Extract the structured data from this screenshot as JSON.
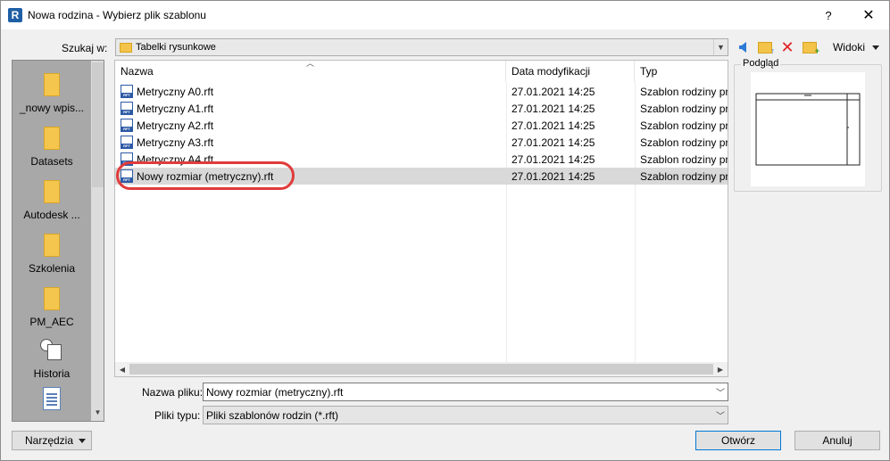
{
  "window": {
    "title": "Nowa rodzina - Wybierz plik szablonu",
    "app_icon_letter": "R",
    "help_label": "?",
    "close_label": "✕"
  },
  "lookin": {
    "label": "Szukaj w:",
    "value": "Tabelki rysunkowe"
  },
  "toolbar": {
    "views_label": "Widoki"
  },
  "places": [
    {
      "label": "_nowy wpis..."
    },
    {
      "label": "Datasets"
    },
    {
      "label": "Autodesk ..."
    },
    {
      "label": "Szkolenia"
    },
    {
      "label": "PM_AEC"
    },
    {
      "label": "Historia"
    }
  ],
  "filelist": {
    "columns": {
      "name": "Nazwa",
      "date": "Data modyfikacji",
      "type": "Typ"
    },
    "rows": [
      {
        "name": "Metryczny A0.rft",
        "date": "27.01.2021 14:25",
        "type": "Szablon rodziny pr..."
      },
      {
        "name": "Metryczny A1.rft",
        "date": "27.01.2021 14:25",
        "type": "Szablon rodziny pr..."
      },
      {
        "name": "Metryczny A2.rft",
        "date": "27.01.2021 14:25",
        "type": "Szablon rodziny pr..."
      },
      {
        "name": "Metryczny A3.rft",
        "date": "27.01.2021 14:25",
        "type": "Szablon rodziny pr..."
      },
      {
        "name": "Metryczny A4.rft",
        "date": "27.01.2021 14:25",
        "type": "Szablon rodziny pr..."
      },
      {
        "name": "Nowy rozmiar (metryczny).rft",
        "date": "27.01.2021 14:25",
        "type": "Szablon rodziny pr..."
      }
    ],
    "selected_index": 5
  },
  "preview": {
    "label": "Podgląd"
  },
  "filename": {
    "label": "Nazwa pliku:",
    "value": "Nowy rozmiar (metryczny).rft"
  },
  "filetype": {
    "label": "Pliki typu:",
    "value": "Pliki szablonów rodzin  (*.rft)"
  },
  "buttons": {
    "tools": "Narzędzia",
    "open": "Otwórz",
    "cancel": "Anuluj"
  },
  "colors": {
    "highlight_ring": "#e03b3b",
    "selection": "#d9d9d9",
    "places_bg": "#a8a8a8"
  }
}
